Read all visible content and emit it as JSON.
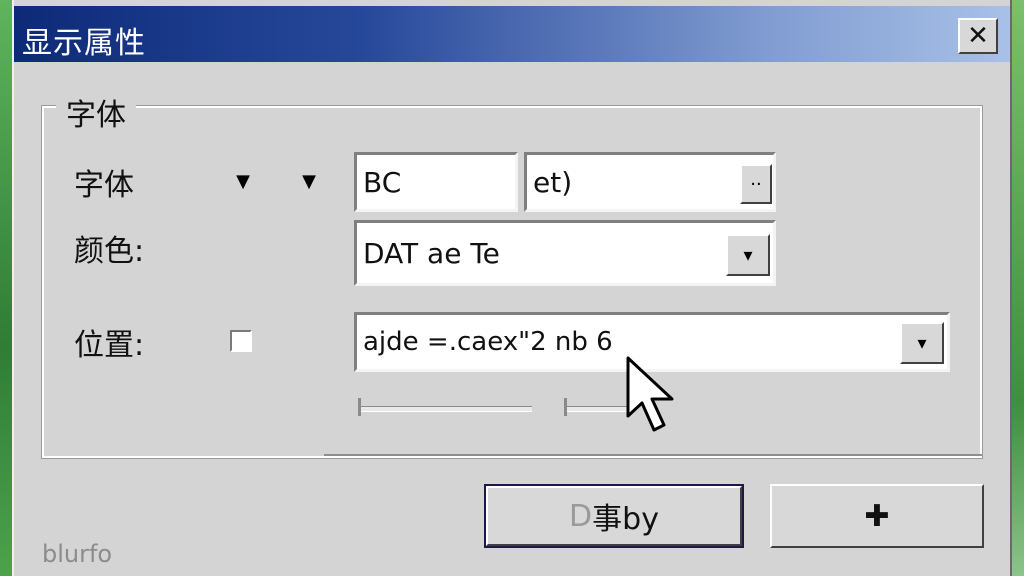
{
  "window": {
    "title": "显示属性",
    "close_glyph": "✕"
  },
  "group": {
    "title": "字体"
  },
  "font_row": {
    "label": "字体",
    "arrow_1": "▼",
    "arrow_2": "▼",
    "field_1_value": "BC",
    "field_2_value": "et)",
    "browse_label": "··"
  },
  "color_row": {
    "label": "颜色:",
    "select_value": "DAT ae Te",
    "dropdown_glyph": "▾"
  },
  "position_row": {
    "label": "位置:",
    "select_value": "ajde =.caex\"2 nb 6",
    "dropdown_glyph": "▾"
  },
  "buttons": {
    "primary_prefix": "D",
    "primary_label": "事by",
    "secondary_glyph": "✚"
  },
  "footer": {
    "text": "blurfo"
  },
  "colors": {
    "title_gradient_start": "#0d2a78",
    "title_gradient_end": "#a9c1e8",
    "dialog_bg": "#d4d4d4",
    "desktop": "#3f9a44"
  }
}
